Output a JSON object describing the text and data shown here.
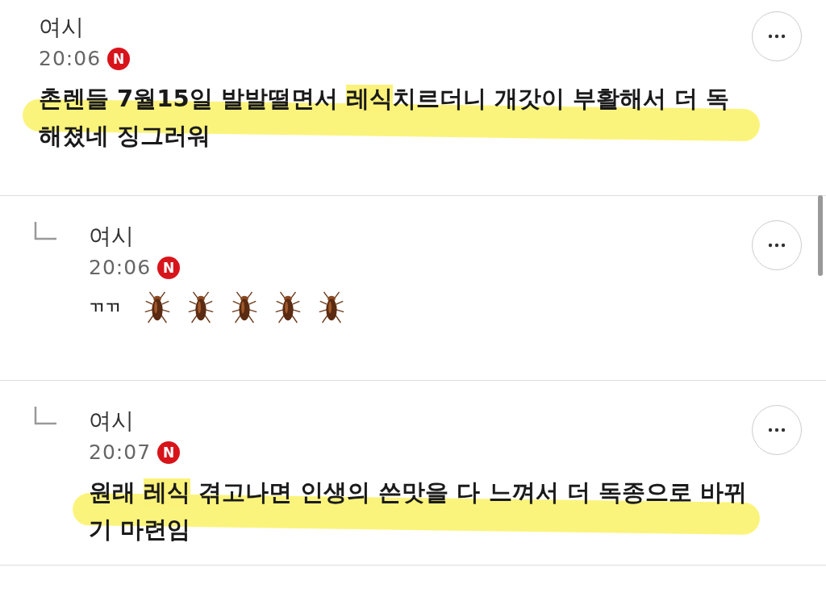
{
  "comments": [
    {
      "kind": "top",
      "author": "여시",
      "time": "20:06",
      "badge": "N",
      "marker_stroke": true,
      "text": [
        {
          "text": "촌렌들 7월15일 발발떨면서 ",
          "highlight": false
        },
        {
          "text": "레식",
          "highlight": true
        },
        {
          "text": "치르더니 개갓이 부활해서 더 독해졌네 징그러워",
          "highlight": false
        }
      ]
    },
    {
      "kind": "reply",
      "author": "여시",
      "time": "20:06",
      "badge": "N",
      "marker_stroke": false,
      "text": [
        {
          "text": "ㄲㄲ",
          "highlight": false
        }
      ],
      "stickers": [
        {
          "kind": "cockroach"
        },
        {
          "kind": "cockroach"
        },
        {
          "kind": "cockroach"
        },
        {
          "kind": "cockroach"
        },
        {
          "kind": "cockroach"
        }
      ]
    },
    {
      "kind": "reply",
      "author": "여시",
      "time": "20:07",
      "badge": "N",
      "marker_stroke": true,
      "text": [
        {
          "text": "원래 ",
          "highlight": false
        },
        {
          "text": "레식",
          "highlight": true
        },
        {
          "text": " 겪고나면 인생의 쓴맛을 다 느껴서 더 독종으로 바뀌기 마련임",
          "highlight": false
        }
      ]
    }
  ]
}
